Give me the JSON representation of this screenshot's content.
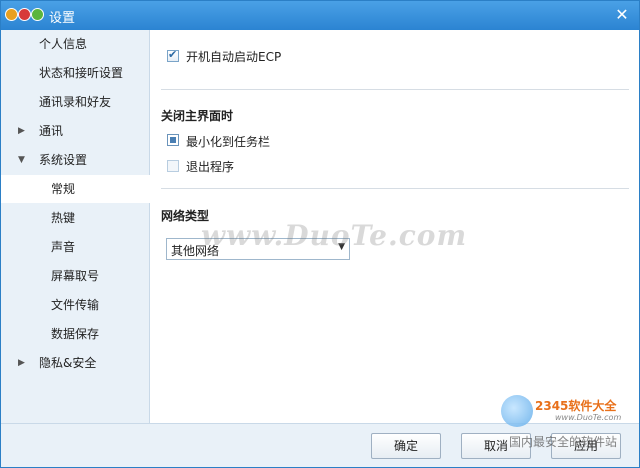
{
  "window": {
    "title": "设置"
  },
  "sidebar": {
    "items": [
      {
        "label": "个人信息"
      },
      {
        "label": "状态和接听设置"
      },
      {
        "label": "通讯录和好友"
      },
      {
        "label": "通讯"
      },
      {
        "label": "系统设置"
      },
      {
        "label": "常规"
      },
      {
        "label": "热键"
      },
      {
        "label": "声音"
      },
      {
        "label": "屏幕取号"
      },
      {
        "label": "文件传输"
      },
      {
        "label": "数据保存"
      },
      {
        "label": "隐私&安全"
      }
    ]
  },
  "main": {
    "autostart": {
      "label": "开机自动启动ECP",
      "checked": true
    },
    "close_section": {
      "title": "关闭主界面时",
      "options": [
        {
          "label": "最小化到任务栏",
          "selected": true
        },
        {
          "label": "退出程序",
          "selected": false
        }
      ]
    },
    "network_section": {
      "title": "网络类型",
      "selected": "其他网络"
    }
  },
  "footer": {
    "ok_label": "确定",
    "cancel_label": "取消",
    "apply_label": "应用"
  },
  "watermark": {
    "text": "www.DuoTe.com"
  },
  "badge": {
    "brand": "2345软件大全",
    "url": "www.DuoTe.com",
    "slogan": "国内最安全的软件站"
  },
  "icons": {
    "close": "close-icon",
    "expand": "triangle-right-icon",
    "collapse": "triangle-down-icon",
    "dropdown": "caret-down-icon"
  }
}
